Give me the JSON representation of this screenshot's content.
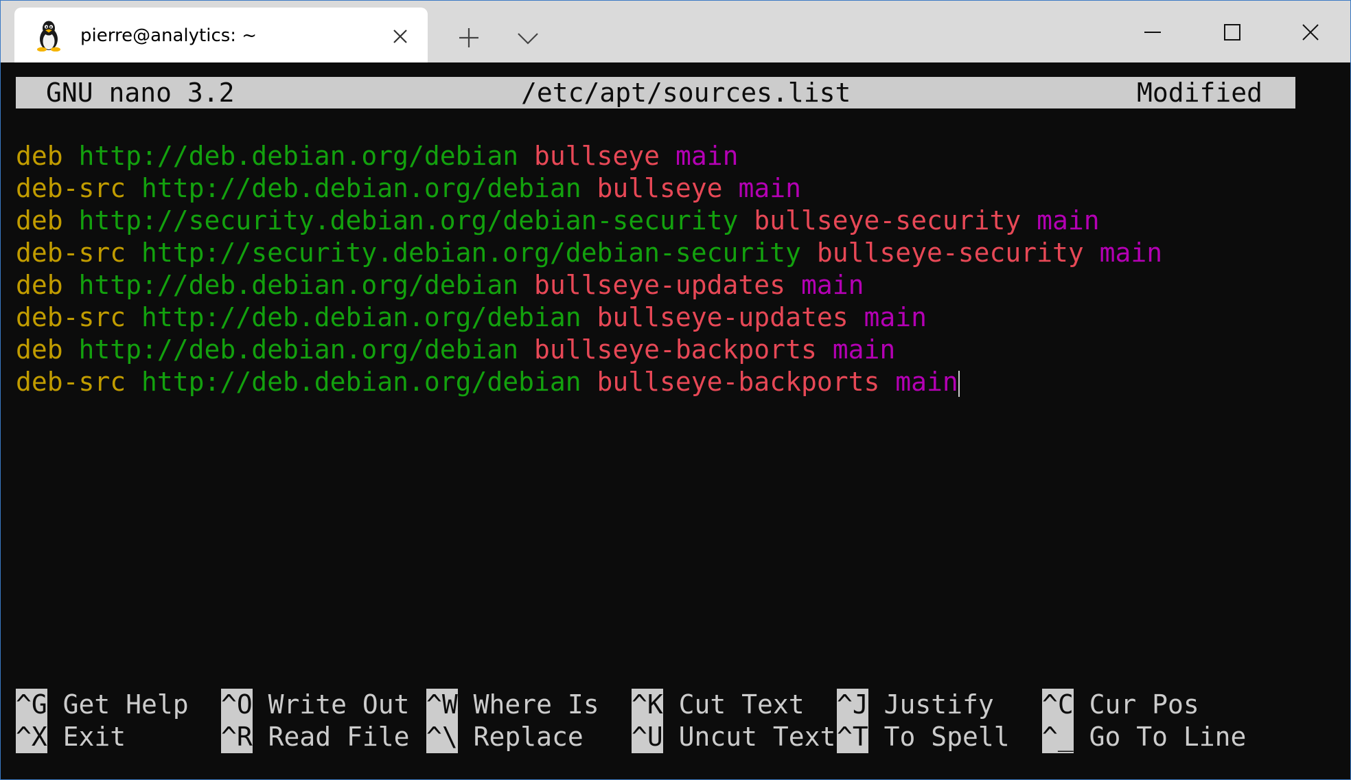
{
  "window": {
    "tab_title": "pierre@analytics: ~",
    "accent_color": "#3a79c4"
  },
  "icons": {
    "tab": "linux-penguin-icon",
    "tab_close": "close-icon",
    "new_tab": "plus-icon",
    "dropdown": "chevron-down-icon",
    "minimize": "minimize-icon",
    "maximize": "maximize-icon",
    "close": "close-icon"
  },
  "nano": {
    "version": "GNU nano 3.2",
    "filename": "/etc/apt/sources.list",
    "status": "Modified"
  },
  "colors": {
    "type": "#c19c00",
    "url": "#13a10e",
    "distribution": "#e74856",
    "component": "#b400b4",
    "background": "#0c0c0c",
    "foreground": "#cccccc"
  },
  "lines": [
    {
      "type": "deb",
      "url": "http://deb.debian.org/debian",
      "dist": "bullseye",
      "comp": "main"
    },
    {
      "type": "deb-src",
      "url": "http://deb.debian.org/debian",
      "dist": "bullseye",
      "comp": "main"
    },
    {
      "type": "deb",
      "url": "http://security.debian.org/debian-security",
      "dist": "bullseye-security",
      "comp": "main"
    },
    {
      "type": "deb-src",
      "url": "http://security.debian.org/debian-security",
      "dist": "bullseye-security",
      "comp": "main"
    },
    {
      "type": "deb",
      "url": "http://deb.debian.org/debian",
      "dist": "bullseye-updates",
      "comp": "main"
    },
    {
      "type": "deb-src",
      "url": "http://deb.debian.org/debian",
      "dist": "bullseye-updates",
      "comp": "main"
    },
    {
      "type": "deb",
      "url": "http://deb.debian.org/debian",
      "dist": "bullseye-backports",
      "comp": "main"
    },
    {
      "type": "deb-src",
      "url": "http://deb.debian.org/debian",
      "dist": "bullseye-backports",
      "comp": "main"
    }
  ],
  "shortcuts": {
    "row1": [
      {
        "key": "^G",
        "label": " Get Help"
      },
      {
        "key": "^O",
        "label": " Write Out"
      },
      {
        "key": "^W",
        "label": " Where Is"
      },
      {
        "key": "^K",
        "label": " Cut Text"
      },
      {
        "key": "^J",
        "label": " Justify"
      },
      {
        "key": "^C",
        "label": " Cur Pos"
      }
    ],
    "row2": [
      {
        "key": "^X",
        "label": " Exit"
      },
      {
        "key": "^R",
        "label": " Read File"
      },
      {
        "key": "^\\",
        "label": " Replace"
      },
      {
        "key": "^U",
        "label": " Uncut Text"
      },
      {
        "key": "^T",
        "label": " To Spell"
      },
      {
        "key": "^_",
        "label": " Go To Line"
      }
    ]
  }
}
